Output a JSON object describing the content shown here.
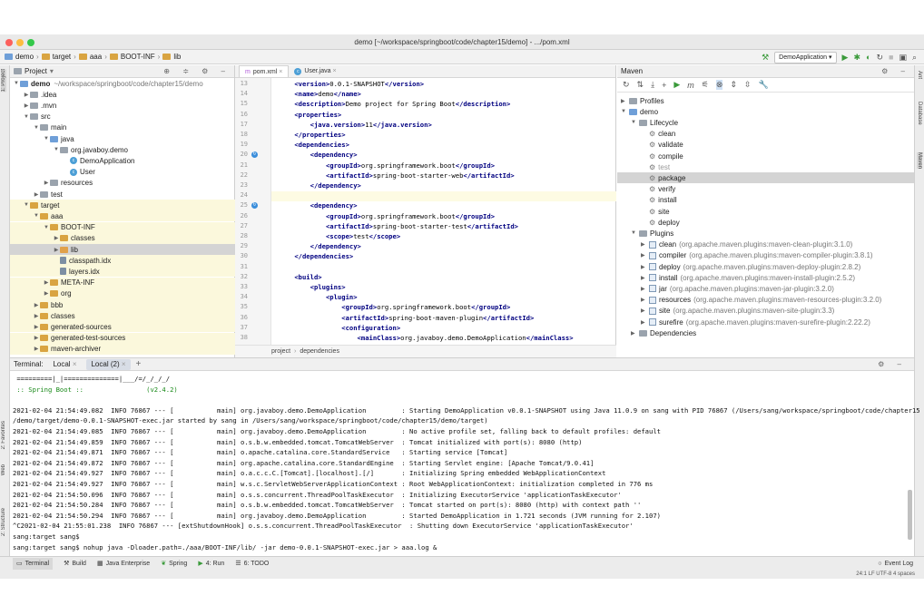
{
  "window": {
    "title": "demo [~/workspace/springboot/code/chapter15/demo] - .../pom.xml"
  },
  "breadcrumbs": [
    "demo",
    "target",
    "aaa",
    "BOOT-INF",
    "lib"
  ],
  "run_config": "DemoApplication",
  "project": {
    "title": "Project",
    "rows": [
      {
        "text": "demo",
        "suffix": "~/workspace/springboot/code/chapter15/demo",
        "depth": 0,
        "arrow": "▼",
        "icon": "fi b"
      },
      {
        "text": ".idea",
        "depth": 1,
        "arrow": "▶",
        "icon": "fi gray"
      },
      {
        "text": ".mvn",
        "depth": 1,
        "arrow": "▶",
        "icon": "fi gray"
      },
      {
        "text": "src",
        "depth": 1,
        "arrow": "▼",
        "icon": "fi gray"
      },
      {
        "text": "main",
        "depth": 2,
        "arrow": "▼",
        "icon": "fi gray"
      },
      {
        "text": "java",
        "depth": 3,
        "arrow": "▼",
        "icon": "fi b"
      },
      {
        "text": "org.javaboy.demo",
        "depth": 4,
        "arrow": "▼",
        "icon": "fi gray"
      },
      {
        "text": "DemoApplication",
        "depth": 5,
        "arrow": "",
        "icon": "ci"
      },
      {
        "text": "User",
        "depth": 5,
        "arrow": "",
        "icon": "ci"
      },
      {
        "text": "resources",
        "depth": 3,
        "arrow": "▶",
        "icon": "fi gray"
      },
      {
        "text": "test",
        "depth": 2,
        "arrow": "▶",
        "icon": "fi gray"
      },
      {
        "text": "target",
        "depth": 1,
        "arrow": "▼",
        "icon": "fi y",
        "hl": "y"
      },
      {
        "text": "aaa",
        "depth": 2,
        "arrow": "▼",
        "icon": "fi y",
        "hl": "y"
      },
      {
        "text": "BOOT-INF",
        "depth": 3,
        "arrow": "▼",
        "icon": "fi y",
        "hl": "y"
      },
      {
        "text": "classes",
        "depth": 4,
        "arrow": "▶",
        "icon": "fi y",
        "hl": "y"
      },
      {
        "text": "lib",
        "depth": 4,
        "arrow": "▶",
        "icon": "fi o",
        "hl": "sel"
      },
      {
        "text": "classpath.idx",
        "depth": 4,
        "arrow": "",
        "icon": "jar",
        "hl": "y"
      },
      {
        "text": "layers.idx",
        "depth": 4,
        "arrow": "",
        "icon": "jar",
        "hl": "y"
      },
      {
        "text": "META-INF",
        "depth": 3,
        "arrow": "▶",
        "icon": "fi y",
        "hl": "y"
      },
      {
        "text": "org",
        "depth": 3,
        "arrow": "▶",
        "icon": "fi y",
        "hl": "y"
      },
      {
        "text": "bbb",
        "depth": 2,
        "arrow": "▶",
        "icon": "fi y",
        "hl": "y"
      },
      {
        "text": "classes",
        "depth": 2,
        "arrow": "▶",
        "icon": "fi y",
        "hl": "y"
      },
      {
        "text": "generated-sources",
        "depth": 2,
        "arrow": "▶",
        "icon": "fi y",
        "hl": "y"
      },
      {
        "text": "generated-test-sources",
        "depth": 2,
        "arrow": "▶",
        "icon": "fi y",
        "hl": "y"
      },
      {
        "text": "maven-archiver",
        "depth": 2,
        "arrow": "▶",
        "icon": "fi y",
        "hl": "y"
      }
    ]
  },
  "editor": {
    "tabs": [
      "pom.xml",
      "User.java"
    ],
    "lines": [
      {
        "n": "13",
        "c": "    <version>0.0.1-SNAPSHOT</version>"
      },
      {
        "n": "14",
        "c": "    <name>demo</name>"
      },
      {
        "n": "15",
        "c": "    <description>Demo project for Spring Boot</description>"
      },
      {
        "n": "16",
        "c": "    <properties>"
      },
      {
        "n": "17",
        "c": "        <java.version>11</java.version>"
      },
      {
        "n": "18",
        "c": "    </properties>"
      },
      {
        "n": "19",
        "c": "    <dependencies>"
      },
      {
        "n": "20",
        "c": "        <dependency>",
        "m": true
      },
      {
        "n": "21",
        "c": "            <groupId>org.springframework.boot</groupId>"
      },
      {
        "n": "22",
        "c": "            <artifactId>spring-boot-starter-web</artifactId>"
      },
      {
        "n": "23",
        "c": "        </dependency>"
      },
      {
        "n": "24",
        "c": "",
        "cur": true
      },
      {
        "n": "25",
        "c": "        <dependency>",
        "m": true
      },
      {
        "n": "26",
        "c": "            <groupId>org.springframework.boot</groupId>"
      },
      {
        "n": "27",
        "c": "            <artifactId>spring-boot-starter-test</artifactId>"
      },
      {
        "n": "28",
        "c": "            <scope>test</scope>"
      },
      {
        "n": "29",
        "c": "        </dependency>"
      },
      {
        "n": "30",
        "c": "    </dependencies>"
      },
      {
        "n": "31",
        "c": ""
      },
      {
        "n": "32",
        "c": "    <build>"
      },
      {
        "n": "33",
        "c": "        <plugins>"
      },
      {
        "n": "34",
        "c": "            <plugin>"
      },
      {
        "n": "35",
        "c": "                <groupId>org.springframework.boot</groupId>"
      },
      {
        "n": "36",
        "c": "                <artifactId>spring-boot-maven-plugin</artifactId>"
      },
      {
        "n": "37",
        "c": "                <configuration>"
      },
      {
        "n": "38",
        "c": "                    <mainClass>org.javaboy.demo.DemoApplication</mainClass>"
      }
    ],
    "crumbs": [
      "project",
      "dependencies"
    ]
  },
  "maven": {
    "title": "Maven",
    "rows": [
      {
        "text": "Profiles",
        "depth": 0,
        "arrow": "▶",
        "icon": "fi gray"
      },
      {
        "text": "demo",
        "depth": 0,
        "arrow": "▼",
        "icon": "fi b"
      },
      {
        "text": "Lifecycle",
        "depth": 1,
        "arrow": "▼",
        "icon": "fi gray"
      },
      {
        "text": "clean",
        "depth": 2,
        "icon": "gear"
      },
      {
        "text": "validate",
        "depth": 2,
        "icon": "gear"
      },
      {
        "text": "compile",
        "depth": 2,
        "icon": "gear"
      },
      {
        "text": "test",
        "depth": 2,
        "icon": "gear",
        "dim": true
      },
      {
        "text": "package",
        "depth": 2,
        "icon": "gear",
        "sel": true
      },
      {
        "text": "verify",
        "depth": 2,
        "icon": "gear"
      },
      {
        "text": "install",
        "depth": 2,
        "icon": "gear"
      },
      {
        "text": "site",
        "depth": 2,
        "icon": "gear"
      },
      {
        "text": "deploy",
        "depth": 2,
        "icon": "gear"
      },
      {
        "text": "Plugins",
        "depth": 1,
        "arrow": "▼",
        "icon": "fi gray"
      },
      {
        "text": "clean",
        "extra": "(org.apache.maven.plugins:maven-clean-plugin:3.1.0)",
        "depth": 2,
        "arrow": "▶",
        "icon": "plug"
      },
      {
        "text": "compiler",
        "extra": "(org.apache.maven.plugins:maven-compiler-plugin:3.8.1)",
        "depth": 2,
        "arrow": "▶",
        "icon": "plug"
      },
      {
        "text": "deploy",
        "extra": "(org.apache.maven.plugins:maven-deploy-plugin:2.8.2)",
        "depth": 2,
        "arrow": "▶",
        "icon": "plug"
      },
      {
        "text": "install",
        "extra": "(org.apache.maven.plugins:maven-install-plugin:2.5.2)",
        "depth": 2,
        "arrow": "▶",
        "icon": "plug"
      },
      {
        "text": "jar",
        "extra": "(org.apache.maven.plugins:maven-jar-plugin:3.2.0)",
        "depth": 2,
        "arrow": "▶",
        "icon": "plug"
      },
      {
        "text": "resources",
        "extra": "(org.apache.maven.plugins:maven-resources-plugin:3.2.0)",
        "depth": 2,
        "arrow": "▶",
        "icon": "plug"
      },
      {
        "text": "site",
        "extra": "(org.apache.maven.plugins:maven-site-plugin:3.3)",
        "depth": 2,
        "arrow": "▶",
        "icon": "plug"
      },
      {
        "text": "surefire",
        "extra": "(org.apache.maven.plugins:maven-surefire-plugin:2.22.2)",
        "depth": 2,
        "arrow": "▶",
        "icon": "plug"
      },
      {
        "text": "Dependencies",
        "depth": 1,
        "arrow": "▶",
        "icon": "fi gray"
      }
    ]
  },
  "terminal": {
    "label": "Terminal:",
    "tabs": [
      "Local",
      "Local (2)"
    ],
    "lines": [
      {
        "t": " =========|_|==============|___/=/_/_/_/"
      },
      {
        "t": " :: Spring Boot ::                (v2.4.2)",
        "cls": "green"
      },
      {
        "t": ""
      },
      {
        "t": "2021-02-04 21:54:49.082  INFO 76867 --- [           main] org.javaboy.demo.DemoApplication         : Starting DemoApplication v0.0.1-SNAPSHOT using Java 11.0.9 on sang with PID 76867 (/Users/sang/workspace/springboot/code/chapter15"
      },
      {
        "t": "/demo/target/demo-0.0.1-SNAPSHOT-exec.jar started by sang in /Users/sang/workspace/springboot/code/chapter15/demo/target)"
      },
      {
        "t": "2021-02-04 21:54:49.085  INFO 76867 --- [           main] org.javaboy.demo.DemoApplication         : No active profile set, falling back to default profiles: default"
      },
      {
        "t": "2021-02-04 21:54:49.859  INFO 76867 --- [           main] o.s.b.w.embedded.tomcat.TomcatWebServer  : Tomcat initialized with port(s): 8080 (http)"
      },
      {
        "t": "2021-02-04 21:54:49.871  INFO 76867 --- [           main] o.apache.catalina.core.StandardService   : Starting service [Tomcat]"
      },
      {
        "t": "2021-02-04 21:54:49.872  INFO 76867 --- [           main] org.apache.catalina.core.StandardEngine  : Starting Servlet engine: [Apache Tomcat/9.0.41]"
      },
      {
        "t": "2021-02-04 21:54:49.927  INFO 76867 --- [           main] o.a.c.c.C.[Tomcat].[localhost].[/]       : Initializing Spring embedded WebApplicationContext"
      },
      {
        "t": "2021-02-04 21:54:49.927  INFO 76867 --- [           main] w.s.c.ServletWebServerApplicationContext : Root WebApplicationContext: initialization completed in 776 ms"
      },
      {
        "t": "2021-02-04 21:54:50.096  INFO 76867 --- [           main] o.s.s.concurrent.ThreadPoolTaskExecutor  : Initializing ExecutorService 'applicationTaskExecutor'"
      },
      {
        "t": "2021-02-04 21:54:50.284  INFO 76867 --- [           main] o.s.b.w.embedded.tomcat.TomcatWebServer  : Tomcat started on port(s): 8080 (http) with context path ''"
      },
      {
        "t": "2021-02-04 21:54:50.294  INFO 76867 --- [           main] org.javaboy.demo.DemoApplication         : Started DemoApplication in 1.721 seconds (JVM running for 2.107)"
      },
      {
        "t": "^C2021-02-04 21:55:01.238  INFO 76867 --- [extShutdownHook] o.s.s.concurrent.ThreadPoolTaskExecutor  : Shutting down ExecutorService 'applicationTaskExecutor'"
      },
      {
        "t": "sang:target sang$"
      },
      {
        "t": "sang:target sang$ nohup java -Dloader.path=./aaa/BOOT-INF/lib/ -jar demo-0.0.1-SNAPSHOT-exec.jar > aaa.log &"
      }
    ]
  },
  "bottom_tabs": [
    "Terminal",
    "Build",
    "Java Enterprise",
    "Spring",
    "4: Run",
    "6: TODO"
  ],
  "event_log": "Event Log",
  "status": "24:1  LF  UTF-8  4 spaces",
  "left_strip": [
    "1: Project",
    "2: Favorites",
    "Web",
    "2: Structure"
  ],
  "right_strip": [
    "Ant",
    "Database",
    "Maven"
  ]
}
